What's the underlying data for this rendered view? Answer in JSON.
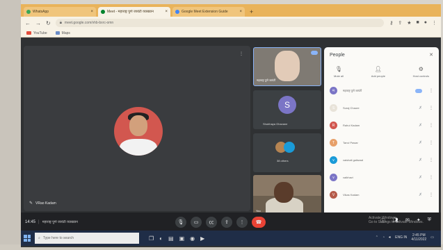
{
  "browser": {
    "tabs": [
      {
        "label": "WhatsApp",
        "active": false
      },
      {
        "label": "Meet - महाराष्ट्र पुणे जायंटी व्याख्यान",
        "active": true
      },
      {
        "label": "Google Meet Extension Guide",
        "active": false
      }
    ],
    "new_tab": "+",
    "url": "meet.google.com/vhb-bxrc-omn",
    "bookmarks": [
      {
        "label": "YouTube",
        "icon": "youtube-icon"
      },
      {
        "label": "Maps",
        "icon": "maps-icon"
      }
    ]
  },
  "meet": {
    "main_participant": "VRao Kadam",
    "tiles": [
      {
        "name": "महाराष्ट्र पुणे जायंटी",
        "type": "video"
      },
      {
        "name": "Shubhaya Ghavane",
        "initial": "S"
      },
      {
        "name": "38 others"
      },
      {
        "name": "You"
      }
    ],
    "clock": "14:45",
    "meeting_title": "महाराष्ट्र पुणे जायंटी व्याख्यान"
  },
  "people_panel": {
    "title": "People",
    "actions": [
      {
        "label": "Mute all",
        "icon": "mic-off-icon"
      },
      {
        "label": "Add people",
        "icon": "add-person-icon"
      },
      {
        "label": "Host controls",
        "icon": "host-controls-icon"
      }
    ],
    "participants": [
      {
        "name": "महाराष्ट्र पुणे जायंटी",
        "initial": "म",
        "color": "#7b75c6"
      },
      {
        "name": "Suraj Chaure",
        "initial": "S",
        "color": "#e8e3d9"
      },
      {
        "name": "Rahul Kadam",
        "initial": "R",
        "color": "#d2574f"
      },
      {
        "name": "Tanvi Pawar",
        "initial": "T",
        "color": "#e7a06a"
      },
      {
        "name": "vaishali gaikwad",
        "initial": "v",
        "color": "#1a9bd8"
      },
      {
        "name": "vaibhavi",
        "initial": "v",
        "color": "#7b75c6"
      },
      {
        "name": "Vikas Kadam",
        "initial": "V",
        "color": "#b55b4a"
      }
    ]
  },
  "watermark": {
    "line1": "Activate Windows",
    "line2": "Go to Settings to activate Windows."
  },
  "taskbar": {
    "search_placeholder": "Type here to search",
    "time": "2:45 PM",
    "date": "4/11/2022",
    "lang": "ENG IN"
  },
  "colors": {
    "tab_accent": "#e9b35a",
    "meet_bg": "#2f3133",
    "end_call": "#ea4335",
    "active_speaker": "#8ab4f8"
  }
}
